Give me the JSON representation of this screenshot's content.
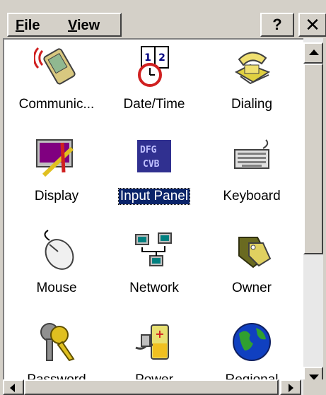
{
  "menu": {
    "file_rest": "ile",
    "file_accel": "F",
    "view_accel": "V",
    "view_rest": "iew"
  },
  "help_label": "?",
  "close_label": "✕",
  "items": [
    {
      "label": "Communic...",
      "icon": "communications-icon"
    },
    {
      "label": "Date/Time",
      "icon": "calendar-clock-icon"
    },
    {
      "label": "Dialing",
      "icon": "telephone-icon"
    },
    {
      "label": "Display",
      "icon": "display-icon"
    },
    {
      "label": "Input Panel",
      "icon": "input-panel-icon",
      "selected": true
    },
    {
      "label": "Keyboard",
      "icon": "keyboard-icon"
    },
    {
      "label": "Mouse",
      "icon": "mouse-icon"
    },
    {
      "label": "Network",
      "icon": "network-icon"
    },
    {
      "label": "Owner",
      "icon": "owner-tag-icon"
    },
    {
      "label": "Password",
      "icon": "keys-icon"
    },
    {
      "label": "Power",
      "icon": "power-battery-icon"
    },
    {
      "label": "Regional",
      "icon": "globe-icon"
    }
  ]
}
